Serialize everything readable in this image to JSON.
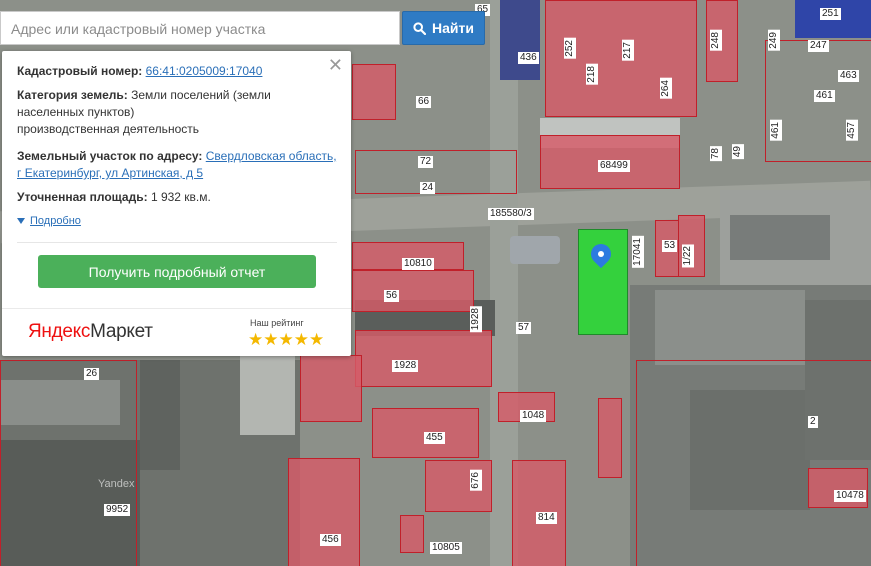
{
  "search": {
    "placeholder": "Адрес или кадастровый номер участка",
    "button_label": "Найти"
  },
  "card": {
    "cadastral_label": "Кадастровый номер:",
    "cadastral_value": "66:41:0205009:17040",
    "category_label": "Категория земель:",
    "category_value_1": "Земли поселений (земли",
    "category_value_2": "населенных пунктов)",
    "category_value_3": "производственная деятельность",
    "address_label": "Земельный участок по адресу:",
    "address_value_1": "Свердловская область,",
    "address_value_2": "г Екатеринбург, ул Артинская, д 5",
    "area_label": "Уточненная площадь:",
    "area_value": "1 932 кв.м.",
    "more_label": "Подробно",
    "report_button": "Получить подробный отчет",
    "brand": {
      "yandex": "Яндекс",
      "market": "Маркет"
    },
    "rating_label": "Наш рейтинг",
    "stars": "★★★★★"
  },
  "map": {
    "watermark": "Yandex",
    "parcel_labels": [
      "65",
      "251",
      "436",
      "252",
      "217",
      "218",
      "248",
      "249",
      "247",
      "66",
      "264",
      "463",
      "461",
      "72",
      "68499",
      "78",
      "49",
      "461",
      "457",
      "24",
      "185580/3",
      "17041",
      "53",
      "1/22",
      "10810",
      "56",
      "1928",
      "57",
      "1928",
      "26",
      "1048",
      "455",
      "2",
      "676",
      "814",
      "10478",
      "9952",
      "456",
      "10805"
    ]
  }
}
